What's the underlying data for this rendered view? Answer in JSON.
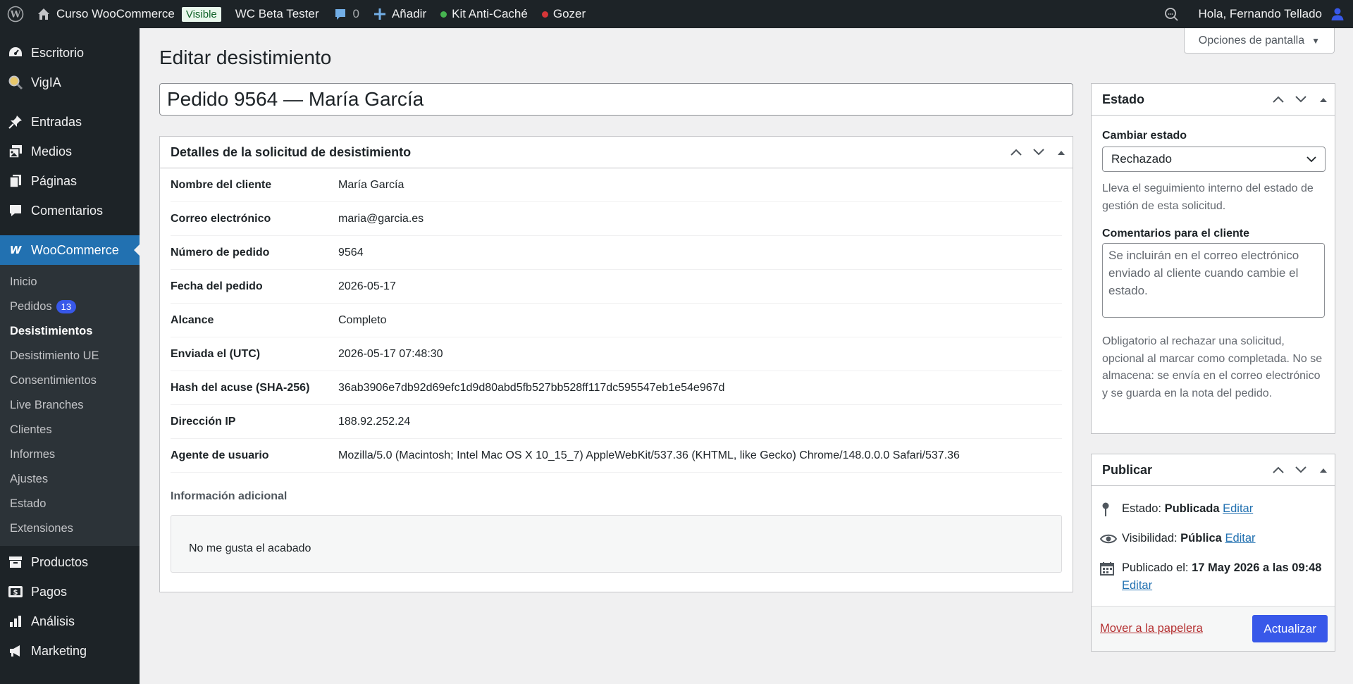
{
  "admin_bar": {
    "site_name": "Curso WooCommerce",
    "visible_badge": "Visible",
    "beta_tester": "WC Beta Tester",
    "comments_count": "0",
    "add_new": "Añadir",
    "anti_cache": "Kit Anti-Caché",
    "gozer": "Gozer",
    "greeting": "Hola, Fernando Tellado",
    "colors": {
      "green_dot": "#46b450",
      "red_dot": "#d63638"
    }
  },
  "sidebar": {
    "top_items": [
      {
        "label": "Escritorio",
        "icon": "dashboard-icon"
      },
      {
        "label": "VigIA",
        "icon": "magnifier-icon"
      }
    ],
    "content_items": [
      {
        "label": "Entradas",
        "icon": "pin-icon"
      },
      {
        "label": "Medios",
        "icon": "media-icon"
      },
      {
        "label": "Páginas",
        "icon": "pages-icon"
      },
      {
        "label": "Comentarios",
        "icon": "comment-icon"
      }
    ],
    "woocommerce": {
      "label": "WooCommerce",
      "submenu": [
        {
          "label": "Inicio"
        },
        {
          "label": "Pedidos",
          "count": "13"
        },
        {
          "label": "Desistimientos"
        },
        {
          "label": "Desistimiento UE"
        },
        {
          "label": "Consentimientos"
        },
        {
          "label": "Live Branches"
        },
        {
          "label": "Clientes"
        },
        {
          "label": "Informes"
        },
        {
          "label": "Ajustes"
        },
        {
          "label": "Estado"
        },
        {
          "label": "Extensiones"
        }
      ]
    },
    "bottom_items": [
      {
        "label": "Productos",
        "icon": "archive-icon"
      },
      {
        "label": "Pagos",
        "icon": "money-icon"
      },
      {
        "label": "Análisis",
        "icon": "chart-bar-icon"
      },
      {
        "label": "Marketing",
        "icon": "megaphone-icon"
      }
    ]
  },
  "screen_options": "Opciones de pantalla",
  "page_title": "Editar desistimiento",
  "post_title": "Pedido 9564 — María García",
  "details": {
    "heading": "Detalles de la solicitud de desistimiento",
    "rows": [
      {
        "label": "Nombre del cliente",
        "value": "María García"
      },
      {
        "label": "Correo electrónico",
        "value": "maria@garcia.es"
      },
      {
        "label": "Número de pedido",
        "value": "9564"
      },
      {
        "label": "Fecha del pedido",
        "value": "2026-05-17"
      },
      {
        "label": "Alcance",
        "value": "Completo"
      },
      {
        "label": "Enviada el (UTC)",
        "value": "2026-05-17 07:48:30"
      },
      {
        "label": "Hash del acuse (SHA-256)",
        "value": "36ab3906e7db92d69efc1d9d80abd5fb527bb528ff117dc595547eb1e54e967d"
      },
      {
        "label": "Dirección IP",
        "value": "188.92.252.24"
      },
      {
        "label": "Agente de usuario",
        "value": "Mozilla/5.0 (Macintosh; Intel Mac OS X 10_15_7) AppleWebKit/537.36 (KHTML, like Gecko) Chrome/148.0.0.0 Safari/537.36"
      }
    ],
    "extra_label": "Información adicional",
    "extra_text": "No me gusta el acabado"
  },
  "estado": {
    "heading": "Estado",
    "change_label": "Cambiar estado",
    "selected": "Rechazado",
    "help1": "Lleva el seguimiento interno del estado de gestión de esta solicitud.",
    "comments_label": "Comentarios para el cliente",
    "comments_placeholder": "Se incluirán en el correo electrónico enviado al cliente cuando cambie el estado.",
    "help2": "Obligatorio al rechazar una solicitud, opcional al marcar como completada. No se almacena: se envía en el correo electrónico y se guarda en la nota del pedido."
  },
  "publicar": {
    "heading": "Publicar",
    "status_label": "Estado:",
    "status_value": "Publicada",
    "visibility_label": "Visibilidad:",
    "visibility_value": "Pública",
    "published_label": "Publicado el:",
    "published_value": "17 May 2026 a las 09:48",
    "edit": "Editar",
    "trash": "Mover a la papelera",
    "update": "Actualizar"
  }
}
